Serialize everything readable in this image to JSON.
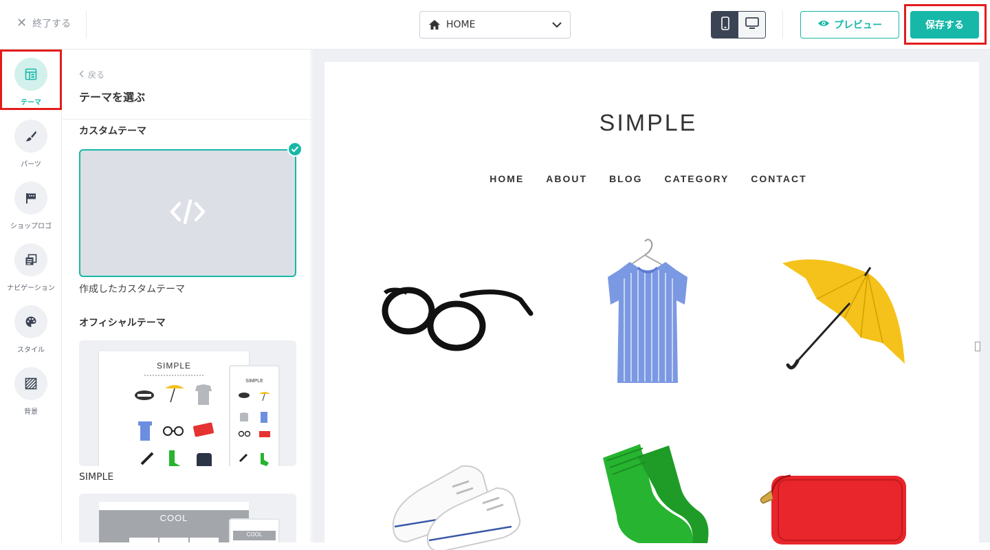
{
  "topbar": {
    "exit_label": "終了する",
    "page_select_value": "HOME",
    "preview_label": "プレビュー",
    "save_label": "保存する"
  },
  "rail": {
    "items": [
      {
        "label": "テーマ",
        "icon": "layout-icon",
        "active": true
      },
      {
        "label": "パーツ",
        "icon": "brush-icon"
      },
      {
        "label": "ショップロゴ",
        "icon": "flag-icon"
      },
      {
        "label": "ナビゲーション",
        "icon": "pages-icon"
      },
      {
        "label": "スタイル",
        "icon": "palette-icon"
      },
      {
        "label": "背景",
        "icon": "pattern-icon"
      }
    ]
  },
  "panel": {
    "back_label": "戻る",
    "title": "テーマを選ぶ",
    "custom_section": "カスタムテーマ",
    "custom_theme_name": "作成したカスタムテーマ",
    "official_section": "オフィシャルテーマ",
    "themes": [
      {
        "name": "SIMPLE",
        "mock_title": "SIMPLE"
      },
      {
        "name": "",
        "mock_title": "COOL"
      }
    ]
  },
  "preview": {
    "site_title": "SIMPLE",
    "nav": [
      "HOME",
      "ABOUT",
      "BLOG",
      "CATEGORY",
      "CONTACT"
    ],
    "products": [
      "glasses",
      "blouse",
      "umbrella",
      "sneakers",
      "socks",
      "wallet"
    ]
  },
  "colors": {
    "accent": "#17b8a8",
    "highlight": "#e31b1b",
    "dark": "#3b4455"
  }
}
